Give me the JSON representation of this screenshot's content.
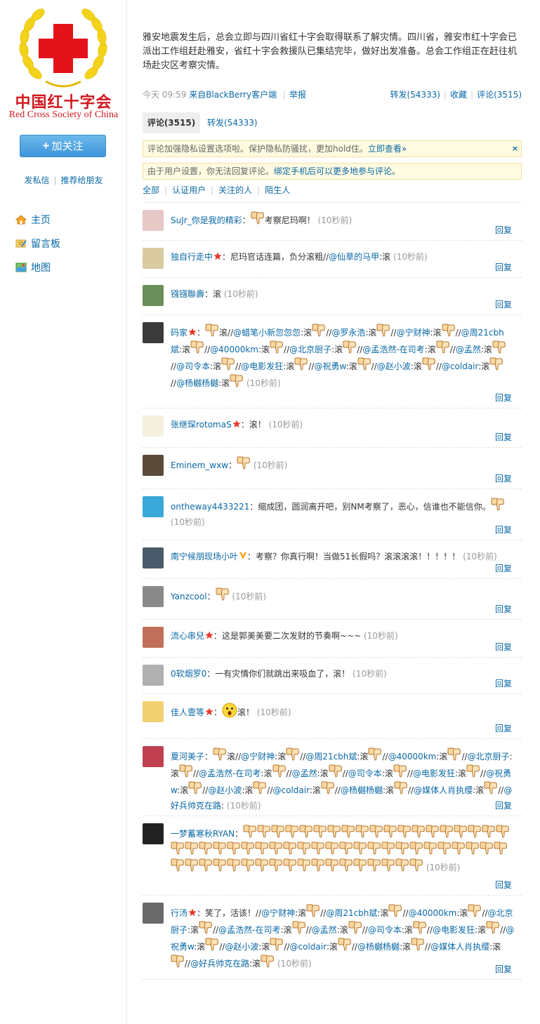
{
  "sidebar": {
    "logo_cn": "中国红十字会",
    "logo_en": "Red Cross Society of China",
    "follow_label": "加关注",
    "links": [
      "发私信",
      "推荐给朋友"
    ],
    "nav": [
      {
        "label": "主页",
        "icon": "home-icon"
      },
      {
        "label": "留言板",
        "icon": "message-board-icon"
      },
      {
        "label": "地图",
        "icon": "map-icon"
      }
    ]
  },
  "status": {
    "text": "雅安地震发生后，总会立即与四川省红十字会取得联系了解灾情。四川省，雅安市红十字会已派出工作组赶赴雅安，省红十字会救援队已集结完毕，做好出发准备。总会工作组正在赶往机场赴灾区考察灾情。",
    "time": "今天 09:59",
    "from": "来自BlackBerry客户端",
    "report": "举报",
    "forward": "转发(54333)",
    "favorite": "收藏",
    "comment": "评论(3515)"
  },
  "tabs": {
    "comments": "评论(3515)",
    "forwards": "转发(54333)"
  },
  "notices": {
    "privacy": "评论加强隐私设置选项啦。保护隐私防骚扰，更加hold住。",
    "privacy_link": "立即查看»",
    "close": "×",
    "reply_block": "由于用户设置，你无法回复评论。",
    "reply_block_link": "绑定手机后可以更多地参与评论。"
  },
  "filters": [
    "全部",
    "认证用户",
    "关注的人",
    "陌生人"
  ],
  "reply_label": "回复",
  "time_label": "(10秒前)",
  "colors": {
    "link": "#0a68a6",
    "brand_red": "#d0181f",
    "notice_bg": "#fffbe1"
  },
  "comments": [
    {
      "name": "SuJr_你是我的精彩",
      "text": "考察尼玛啊！",
      "avatar_color": "#e8c7c7"
    },
    {
      "name": "独自行走中",
      "text": "尼玛官话连篇，负分滚粗//",
      "mention": "@仙草的马甲",
      "tail": ":滚",
      "avatar_color": "#d9caa0"
    },
    {
      "name": "镪镪聯壽",
      "text": "滚",
      "avatar_color": "#6b8e5a"
    },
    {
      "name": "码家",
      "chain": [
        "@蜡笔小新忽忽忽",
        "@罗永浩",
        "@宁财神",
        "@周21cbh斌",
        "@40000km",
        "@北京厨子",
        "@孟浩然-在司考",
        "@孟然",
        "@司令本",
        "@电影发狂",
        "@祝勇w",
        "@赵小波",
        "@coldair",
        "@杨樾杨樾"
      ],
      "avatar_color": "#3a3a3a"
    },
    {
      "name": "张继琛rotomaS",
      "text": "滚！",
      "avatar_color": "#f4f0e0"
    },
    {
      "name": "Eminem_wxw",
      "avatar_color": "#5a4a3a"
    },
    {
      "name": "ontheway4433221",
      "text": "缩成团，圆润离开吧，别NM考察了，恶心，信谁也不能信你。",
      "avatar_color": "#3aa8d8"
    },
    {
      "name": "南宁候朋现场小叶",
      "text": "考察？你真行啊！当做51长假吗？滚滚滚滚！！！！！",
      "avatar_color": "#4a5a6a"
    },
    {
      "name": "Yanzcool",
      "avatar_color": "#8a8a8a"
    },
    {
      "name": "流心串兒",
      "text": "这是郭美美要二次发财的节奏啊~~~",
      "avatar_color": "#c0705a"
    },
    {
      "name": "0软烟罗0",
      "text": "一有灾情你们就跳出来吸血了，滚！",
      "avatar_color": "#b0b0b0"
    },
    {
      "name": "佳人壹等",
      "text": "滚！",
      "avatar_color": "#f0d070"
    },
    {
      "name": "夏河美子",
      "chain": [
        "@宁财神",
        "@周21cbh斌",
        "@40000km",
        "@北京厨子",
        "@孟浩然-在司考",
        "@孟然",
        "@司令本",
        "@电影发狂",
        "@祝勇w",
        "@赵小波",
        "@coldair",
        "@杨樾杨樾",
        "@媒体人肖执缨",
        "@好兵帅克在路"
      ],
      "avatar_color": "#c04050"
    },
    {
      "name": "一梦蓄寒秋RYAN",
      "thumbs": 61,
      "avatar_color": "#222222"
    },
    {
      "name": "行汤",
      "text": "笑了，活该！",
      "chain": [
        "@宁财神",
        "@周21cbh斌",
        "@40000km",
        "@北京厨子",
        "@孟浩然-在司考",
        "@孟然",
        "@司令本",
        "@电影发狂",
        "@祝勇w",
        "@赵小波",
        "@coldair",
        "@杨樾杨樾",
        "@媒体人肖执缨",
        "@好兵帅克在路"
      ],
      "avatar_color": "#6a6a6a"
    }
  ]
}
